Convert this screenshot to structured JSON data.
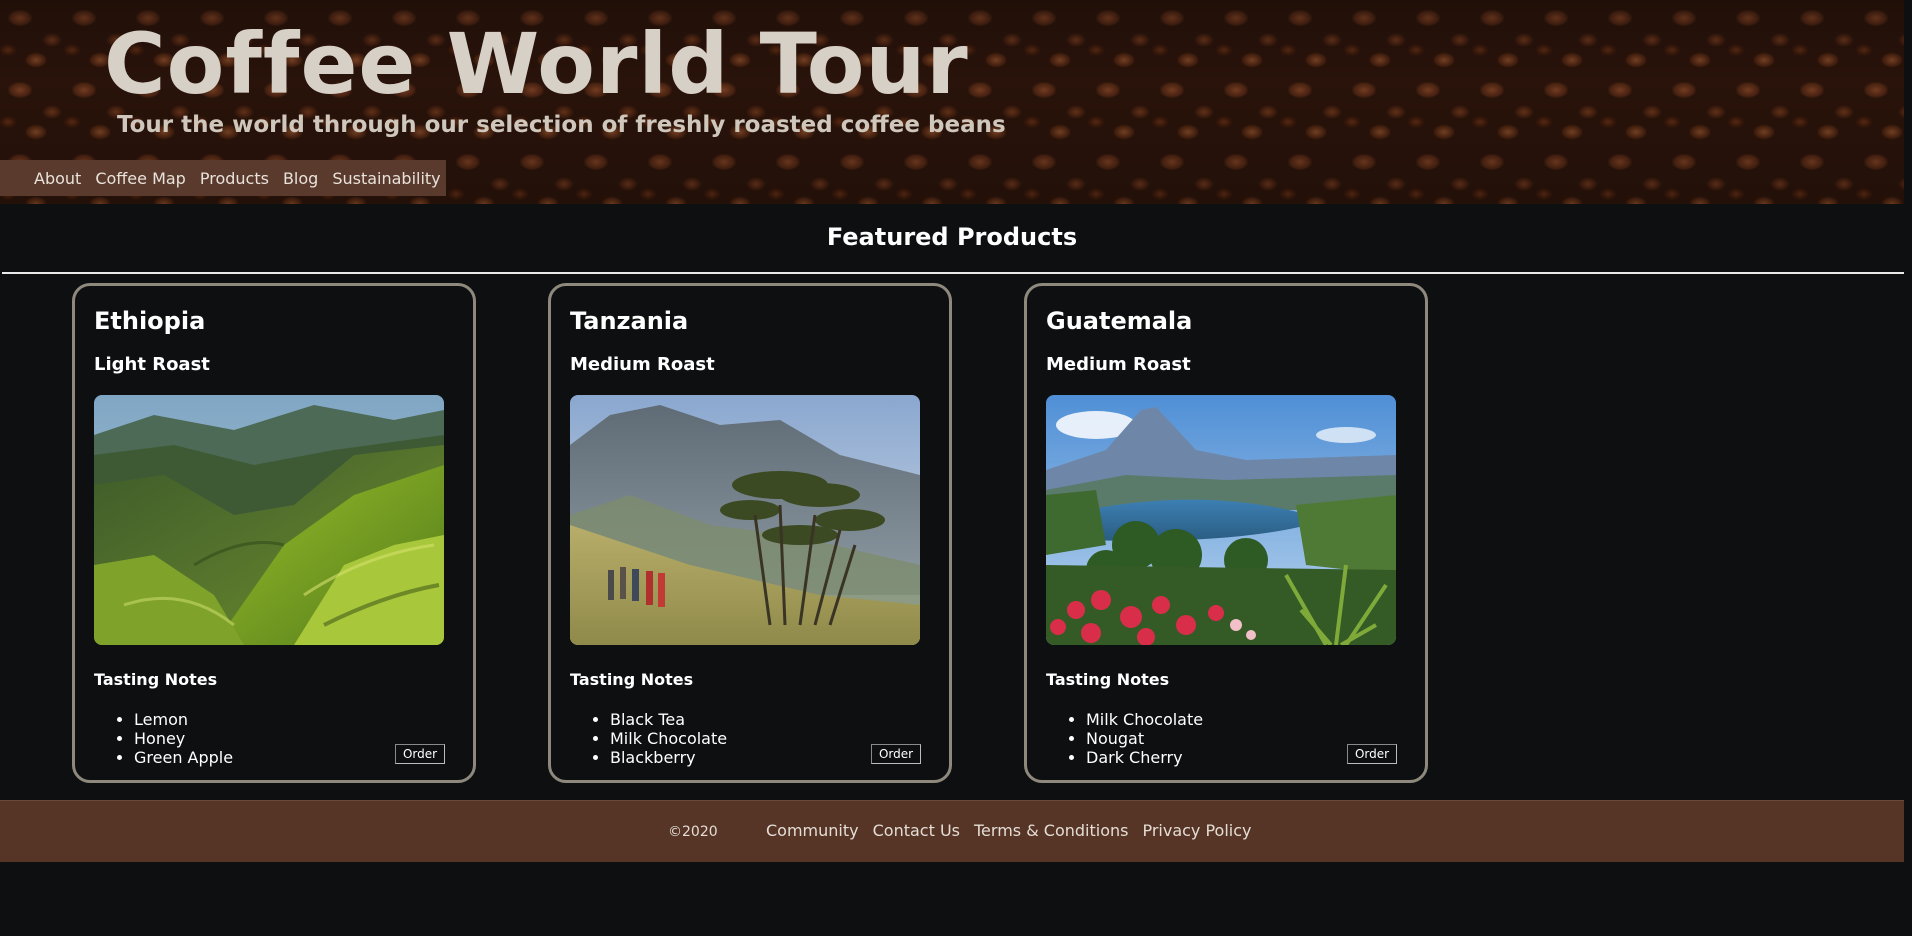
{
  "header": {
    "title": "Coffee World Tour",
    "subtitle": "Tour the world through our selection of freshly roasted coffee beans",
    "nav": [
      "About",
      "Coffee Map",
      "Products",
      "Blog",
      "Sustainability"
    ]
  },
  "featured": {
    "heading": "Featured Products",
    "products": [
      {
        "country": "Ethiopia",
        "roast": "Light Roast",
        "notes_heading": "Tasting Notes",
        "notes": [
          "Lemon",
          "Honey",
          "Green Apple"
        ],
        "order_label": "Order"
      },
      {
        "country": "Tanzania",
        "roast": "Medium Roast",
        "notes_heading": "Tasting Notes",
        "notes": [
          "Black Tea",
          "Milk Chocolate",
          "Blackberry"
        ],
        "order_label": "Order"
      },
      {
        "country": "Guatemala",
        "roast": "Medium Roast",
        "notes_heading": "Tasting Notes",
        "notes": [
          "Milk Chocolate",
          "Nougat",
          "Dark Cherry"
        ],
        "order_label": "Order"
      }
    ]
  },
  "footer": {
    "copyright": "©2020",
    "links": [
      "Community",
      "Contact Us",
      "Terms & Conditions",
      "Privacy Policy"
    ]
  },
  "colors": {
    "background": "#0d0f10",
    "nav_background": "#5b3a2e",
    "footer_background": "#563527",
    "card_border": "#8f897d",
    "title_text": "#d6d0c6"
  }
}
